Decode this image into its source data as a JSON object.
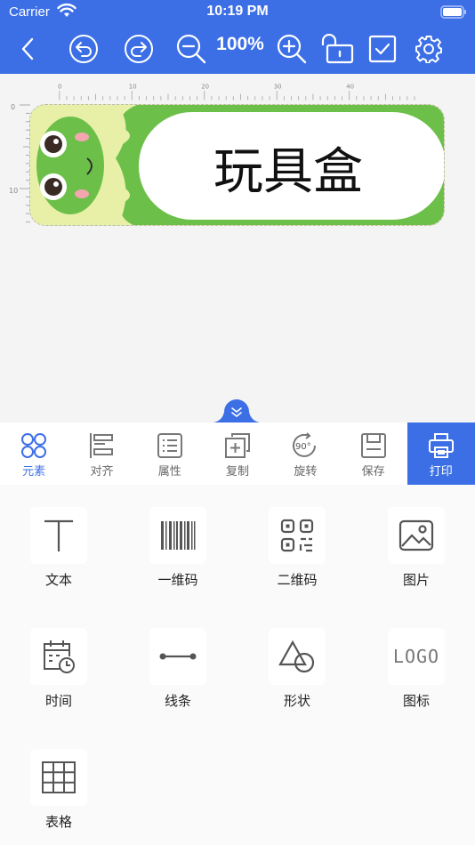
{
  "status_bar": {
    "carrier": "Carrier",
    "time": "10:19 PM"
  },
  "toolbar": {
    "zoom_level": "100%"
  },
  "ruler": {
    "top_ticks": [
      "0",
      "10",
      "20",
      "30",
      "40"
    ],
    "left_ticks": [
      "0",
      "10"
    ]
  },
  "label": {
    "text": "玩具盒"
  },
  "tabs": [
    {
      "label": "元素",
      "icon": "elements-icon"
    },
    {
      "label": "对齐",
      "icon": "align-icon"
    },
    {
      "label": "属性",
      "icon": "properties-icon"
    },
    {
      "label": "复制",
      "icon": "copy-icon"
    },
    {
      "label": "旋转",
      "icon": "rotate-icon",
      "badge": "90°"
    },
    {
      "label": "保存",
      "icon": "save-icon"
    },
    {
      "label": "打印",
      "icon": "print-icon"
    }
  ],
  "elements": [
    {
      "label": "文本",
      "icon": "text-icon"
    },
    {
      "label": "一维码",
      "icon": "barcode-icon"
    },
    {
      "label": "二维码",
      "icon": "qrcode-icon"
    },
    {
      "label": "图片",
      "icon": "image-icon"
    },
    {
      "label": "时间",
      "icon": "time-icon"
    },
    {
      "label": "线条",
      "icon": "line-icon"
    },
    {
      "label": "形状",
      "icon": "shape-icon"
    },
    {
      "label": "图标",
      "icon": "logo-icon",
      "icon_text": "LOGO"
    },
    {
      "label": "表格",
      "icon": "table-icon"
    }
  ],
  "colors": {
    "primary": "#3c6fe6",
    "frog_green": "#6cc04a",
    "label_bg": "#e8f0a8"
  }
}
